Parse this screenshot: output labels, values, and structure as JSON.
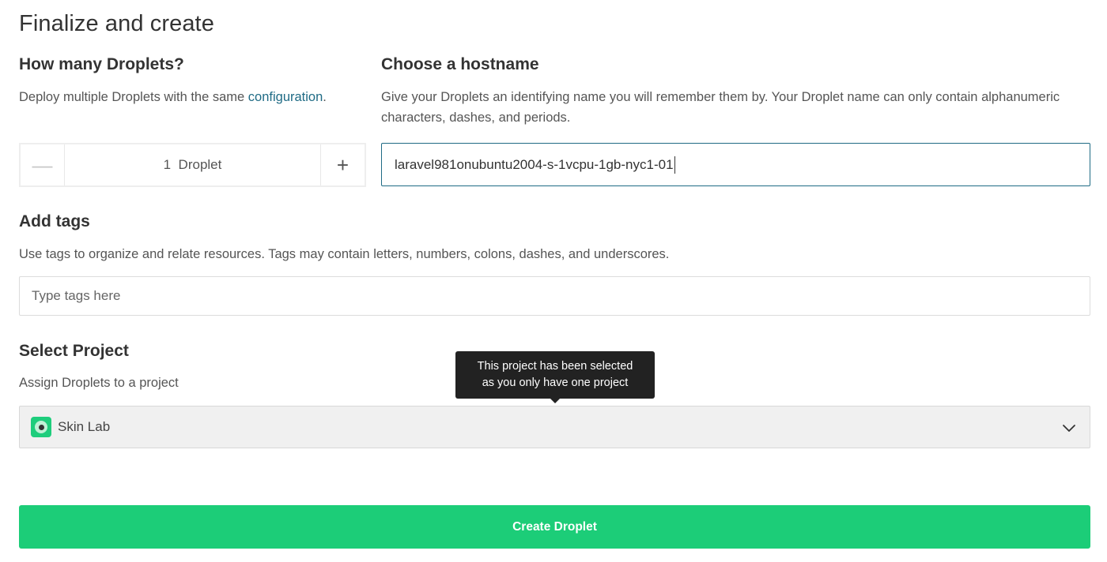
{
  "page": {
    "title": "Finalize and create"
  },
  "droplets": {
    "heading": "How many Droplets?",
    "desc_prefix": "Deploy multiple Droplets with the same ",
    "desc_link": "configuration",
    "desc_suffix": ".",
    "count": "1",
    "unit": "Droplet",
    "minus_symbol": "—",
    "plus_symbol": "+"
  },
  "hostname": {
    "heading": "Choose a hostname",
    "desc": "Give your Droplets an identifying name you will remember them by. Your Droplet name can only contain alphanumeric characters, dashes, and periods.",
    "value": "laravel981onubuntu2004-s-1vcpu-1gb-nyc1-01"
  },
  "tags": {
    "heading": "Add tags",
    "desc": "Use tags to organize and relate resources. Tags may contain letters, numbers, colons, dashes, and underscores.",
    "placeholder": "Type tags here"
  },
  "project": {
    "heading": "Select Project",
    "desc": "Assign Droplets to a project",
    "selected": "Skin Lab",
    "tooltip_line1": "This project has been selected",
    "tooltip_line2": "as you only have one project",
    "icon": "project-icon",
    "chevron": "chevron-down-icon"
  },
  "actions": {
    "create_label": "Create Droplet"
  },
  "colors": {
    "accent": "#1ccd78",
    "link": "#1f6b85",
    "tooltip_bg": "#222222"
  }
}
